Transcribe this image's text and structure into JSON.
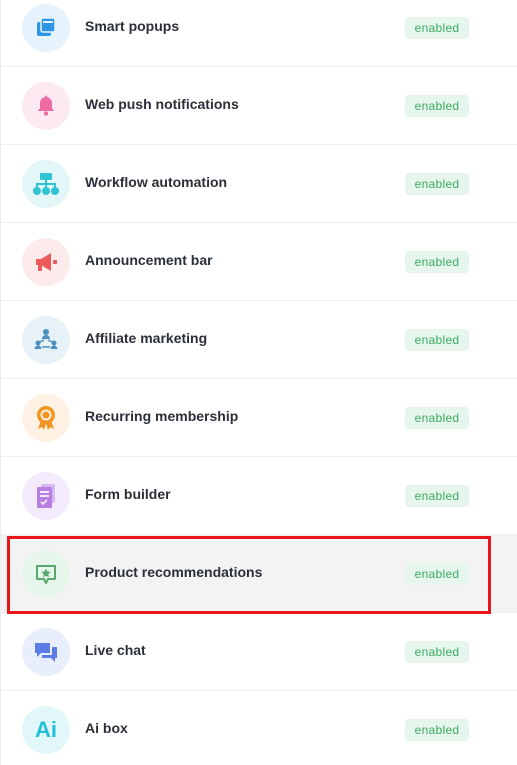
{
  "features": [
    {
      "label": "Smart popups",
      "status": "enabled",
      "icon": "popup-window-icon",
      "icon_bg": "#e6f3fd",
      "icon_color": "#2f96e6"
    },
    {
      "label": "Web push notifications",
      "status": "enabled",
      "icon": "bell-icon",
      "icon_bg": "#fde9f2",
      "icon_color": "#f06aa3"
    },
    {
      "label": "Workflow automation",
      "status": "enabled",
      "icon": "sitemap-icon",
      "icon_bg": "#e3f7f9",
      "icon_color": "#2dc3d3"
    },
    {
      "label": "Announcement bar",
      "status": "enabled",
      "icon": "megaphone-icon",
      "icon_bg": "#fdeaea",
      "icon_color": "#ec5a5a"
    },
    {
      "label": "Affiliate marketing",
      "status": "enabled",
      "icon": "network-people-icon",
      "icon_bg": "#e7f1f8",
      "icon_color": "#4b8fbf"
    },
    {
      "label": "Recurring membership",
      "status": "enabled",
      "icon": "award-ribbon-icon",
      "icon_bg": "#fff1e3",
      "icon_color": "#f29422"
    },
    {
      "label": "Form builder",
      "status": "enabled",
      "icon": "form-document-icon",
      "icon_bg": "#f3eafb",
      "icon_color": "#b77fe0"
    },
    {
      "label": "Product recommendations",
      "status": "enabled",
      "icon": "star-message-icon",
      "icon_bg": "#e6f6ea",
      "icon_color": "#5aa86d"
    },
    {
      "label": "Live chat",
      "status": "enabled",
      "icon": "chat-bubbles-icon",
      "icon_bg": "#e9eefc",
      "icon_color": "#5c7de6"
    },
    {
      "label": "Ai box",
      "status": "enabled",
      "icon": "ai-icon",
      "icon_bg": "#e1f7fa",
      "icon_color": "#22bfd6",
      "icon_text": "Ai"
    }
  ],
  "colors": {
    "highlight": "#e8151b",
    "badge_bg": "#e7f6ec",
    "badge_text": "#3aaa62"
  }
}
